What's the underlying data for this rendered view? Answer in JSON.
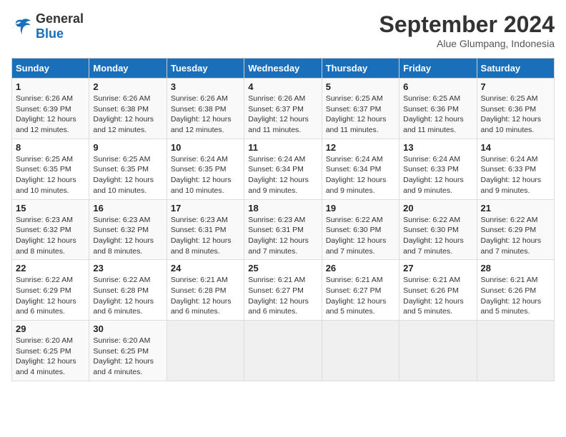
{
  "logo": {
    "line1": "General",
    "line2": "Blue"
  },
  "title": "September 2024",
  "location": "Alue Glumpang, Indonesia",
  "days_header": [
    "Sunday",
    "Monday",
    "Tuesday",
    "Wednesday",
    "Thursday",
    "Friday",
    "Saturday"
  ],
  "weeks": [
    [
      {
        "num": "1",
        "detail": "Sunrise: 6:26 AM\nSunset: 6:39 PM\nDaylight: 12 hours\nand 12 minutes."
      },
      {
        "num": "2",
        "detail": "Sunrise: 6:26 AM\nSunset: 6:38 PM\nDaylight: 12 hours\nand 12 minutes."
      },
      {
        "num": "3",
        "detail": "Sunrise: 6:26 AM\nSunset: 6:38 PM\nDaylight: 12 hours\nand 12 minutes."
      },
      {
        "num": "4",
        "detail": "Sunrise: 6:26 AM\nSunset: 6:37 PM\nDaylight: 12 hours\nand 11 minutes."
      },
      {
        "num": "5",
        "detail": "Sunrise: 6:25 AM\nSunset: 6:37 PM\nDaylight: 12 hours\nand 11 minutes."
      },
      {
        "num": "6",
        "detail": "Sunrise: 6:25 AM\nSunset: 6:36 PM\nDaylight: 12 hours\nand 11 minutes."
      },
      {
        "num": "7",
        "detail": "Sunrise: 6:25 AM\nSunset: 6:36 PM\nDaylight: 12 hours\nand 10 minutes."
      }
    ],
    [
      {
        "num": "8",
        "detail": "Sunrise: 6:25 AM\nSunset: 6:35 PM\nDaylight: 12 hours\nand 10 minutes."
      },
      {
        "num": "9",
        "detail": "Sunrise: 6:25 AM\nSunset: 6:35 PM\nDaylight: 12 hours\nand 10 minutes."
      },
      {
        "num": "10",
        "detail": "Sunrise: 6:24 AM\nSunset: 6:35 PM\nDaylight: 12 hours\nand 10 minutes."
      },
      {
        "num": "11",
        "detail": "Sunrise: 6:24 AM\nSunset: 6:34 PM\nDaylight: 12 hours\nand 9 minutes."
      },
      {
        "num": "12",
        "detail": "Sunrise: 6:24 AM\nSunset: 6:34 PM\nDaylight: 12 hours\nand 9 minutes."
      },
      {
        "num": "13",
        "detail": "Sunrise: 6:24 AM\nSunset: 6:33 PM\nDaylight: 12 hours\nand 9 minutes."
      },
      {
        "num": "14",
        "detail": "Sunrise: 6:24 AM\nSunset: 6:33 PM\nDaylight: 12 hours\nand 9 minutes."
      }
    ],
    [
      {
        "num": "15",
        "detail": "Sunrise: 6:23 AM\nSunset: 6:32 PM\nDaylight: 12 hours\nand 8 minutes."
      },
      {
        "num": "16",
        "detail": "Sunrise: 6:23 AM\nSunset: 6:32 PM\nDaylight: 12 hours\nand 8 minutes."
      },
      {
        "num": "17",
        "detail": "Sunrise: 6:23 AM\nSunset: 6:31 PM\nDaylight: 12 hours\nand 8 minutes."
      },
      {
        "num": "18",
        "detail": "Sunrise: 6:23 AM\nSunset: 6:31 PM\nDaylight: 12 hours\nand 7 minutes."
      },
      {
        "num": "19",
        "detail": "Sunrise: 6:22 AM\nSunset: 6:30 PM\nDaylight: 12 hours\nand 7 minutes."
      },
      {
        "num": "20",
        "detail": "Sunrise: 6:22 AM\nSunset: 6:30 PM\nDaylight: 12 hours\nand 7 minutes."
      },
      {
        "num": "21",
        "detail": "Sunrise: 6:22 AM\nSunset: 6:29 PM\nDaylight: 12 hours\nand 7 minutes."
      }
    ],
    [
      {
        "num": "22",
        "detail": "Sunrise: 6:22 AM\nSunset: 6:29 PM\nDaylight: 12 hours\nand 6 minutes."
      },
      {
        "num": "23",
        "detail": "Sunrise: 6:22 AM\nSunset: 6:28 PM\nDaylight: 12 hours\nand 6 minutes."
      },
      {
        "num": "24",
        "detail": "Sunrise: 6:21 AM\nSunset: 6:28 PM\nDaylight: 12 hours\nand 6 minutes."
      },
      {
        "num": "25",
        "detail": "Sunrise: 6:21 AM\nSunset: 6:27 PM\nDaylight: 12 hours\nand 6 minutes."
      },
      {
        "num": "26",
        "detail": "Sunrise: 6:21 AM\nSunset: 6:27 PM\nDaylight: 12 hours\nand 5 minutes."
      },
      {
        "num": "27",
        "detail": "Sunrise: 6:21 AM\nSunset: 6:26 PM\nDaylight: 12 hours\nand 5 minutes."
      },
      {
        "num": "28",
        "detail": "Sunrise: 6:21 AM\nSunset: 6:26 PM\nDaylight: 12 hours\nand 5 minutes."
      }
    ],
    [
      {
        "num": "29",
        "detail": "Sunrise: 6:20 AM\nSunset: 6:25 PM\nDaylight: 12 hours\nand 4 minutes."
      },
      {
        "num": "30",
        "detail": "Sunrise: 6:20 AM\nSunset: 6:25 PM\nDaylight: 12 hours\nand 4 minutes."
      },
      {
        "num": "",
        "detail": ""
      },
      {
        "num": "",
        "detail": ""
      },
      {
        "num": "",
        "detail": ""
      },
      {
        "num": "",
        "detail": ""
      },
      {
        "num": "",
        "detail": ""
      }
    ]
  ]
}
